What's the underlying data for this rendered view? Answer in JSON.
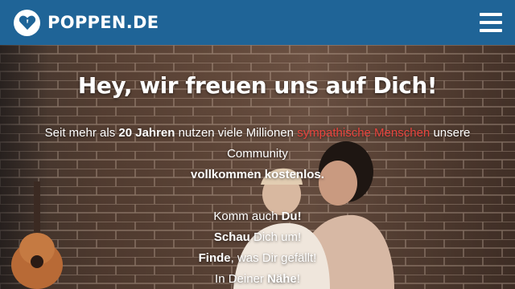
{
  "header": {
    "brand_name": "POPPEN.DE",
    "logo_icon": "heart-icon",
    "menu_icon": "hamburger-menu-icon"
  },
  "hero": {
    "title": "Hey, wir freuen uns auf Dich!",
    "intro": {
      "prefix": "Seit mehr als ",
      "years": "20 Jahren",
      "middle": " nutzen viele Millionen ",
      "highlight": "sympathische Menschen",
      "suffix": " unsere",
      "line2": "Community",
      "line3": "vollkommen kostenlos."
    },
    "cta_lines": [
      {
        "bold": "",
        "text": "Komm auch ",
        "bold_after": "Du!"
      },
      {
        "bold": "Schau",
        "text": " Dich um!",
        "bold_after": ""
      },
      {
        "bold": "Finde",
        "text": ", was Dir gefällt!",
        "bold_after": ""
      },
      {
        "text": "In Deiner ",
        "bold_after": "Nähe",
        "tail": "!"
      }
    ]
  },
  "colors": {
    "header_bg": "#1f6497",
    "highlight": "#e8433d",
    "text": "#ffffff"
  }
}
